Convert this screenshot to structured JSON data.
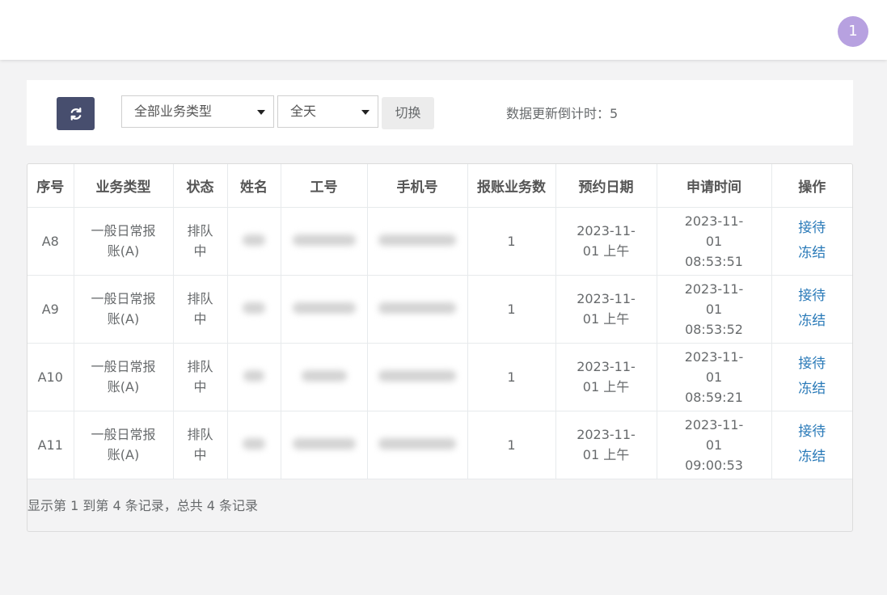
{
  "header": {
    "badge_count": "1"
  },
  "toolbar": {
    "refresh_icon": "refresh-icon",
    "business_type_select": "全部业务类型",
    "time_select": "全天",
    "switch_label": "切换",
    "countdown_label": "数据更新倒计时：5"
  },
  "table": {
    "columns": [
      "序号",
      "业务类型",
      "状态",
      "姓名",
      "工号",
      "手机号",
      "报账业务数",
      "预约日期",
      "申请时间",
      "操作"
    ],
    "rows": [
      {
        "seq": "A8",
        "type": "一般日常报账(A)",
        "status": "排队中",
        "count": "1",
        "date": "2023-11-01 上午",
        "time": "2023-11-01 08:53:51",
        "action_accept": "接待",
        "action_freeze": "冻结"
      },
      {
        "seq": "A9",
        "type": "一般日常报账(A)",
        "status": "排队中",
        "count": "1",
        "date": "2023-11-01 上午",
        "time": "2023-11-01 08:53:52",
        "action_accept": "接待",
        "action_freeze": "冻结"
      },
      {
        "seq": "A10",
        "type": "一般日常报账(A)",
        "status": "排队中",
        "count": "1",
        "date": "2023-11-01 上午",
        "time": "2023-11-01 08:59:21",
        "action_accept": "接待",
        "action_freeze": "冻结"
      },
      {
        "seq": "A11",
        "type": "一般日常报账(A)",
        "status": "排队中",
        "count": "1",
        "date": "2023-11-01 上午",
        "time": "2023-11-01 09:00:53",
        "action_accept": "接待",
        "action_freeze": "冻结"
      }
    ]
  },
  "footer": {
    "summary": "显示第 1 到第 4 条记录，总共 4 条记录"
  },
  "colors": {
    "primary_button": "#474e6e",
    "link": "#2a7ab8",
    "badge": "#b7a1e0"
  }
}
